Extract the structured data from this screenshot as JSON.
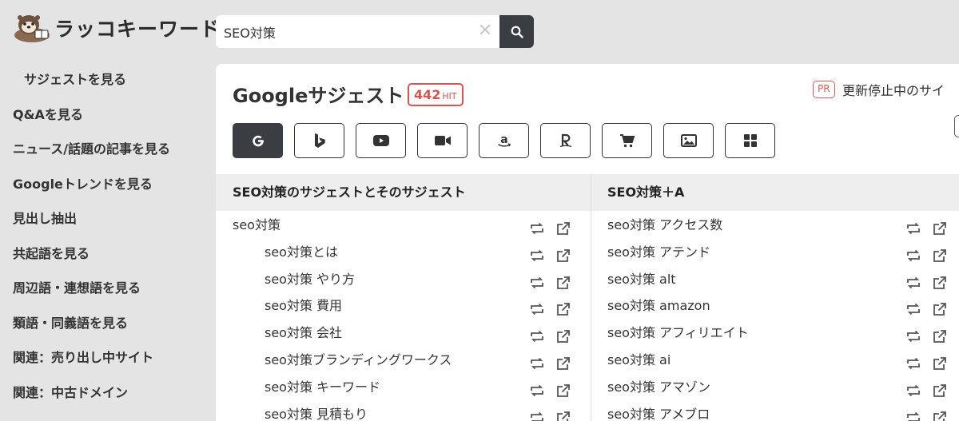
{
  "app": {
    "logo_text": "ラッコキーワード"
  },
  "search": {
    "value": "SEO対策",
    "clear_glyph": "✕"
  },
  "sidebar": {
    "items": [
      {
        "label": "サジェストを見る",
        "active": true
      },
      {
        "label": "Q&Aを見る"
      },
      {
        "label": "ニュース/話題の記事を見る"
      },
      {
        "label": "Googleトレンドを見る"
      },
      {
        "label": "見出し抽出"
      },
      {
        "label": "共起語を見る"
      },
      {
        "label": "周辺語・連想語を見る"
      },
      {
        "label": "類語・同義語を見る"
      },
      {
        "label": "関連：売り出し中サイト"
      },
      {
        "label": "関連：中古ドメイン"
      }
    ]
  },
  "main": {
    "title": "Googleサジェスト",
    "hit_count": "442",
    "hit_unit": "HIT",
    "pr_badge": "PR",
    "pr_text": "更新停止中のサイ",
    "engines": [
      {
        "name": "google",
        "icon": "google-icon",
        "active": true
      },
      {
        "name": "bing",
        "icon": "bing-icon"
      },
      {
        "name": "youtube",
        "icon": "youtube-icon"
      },
      {
        "name": "video",
        "icon": "video-camera-icon"
      },
      {
        "name": "amazon",
        "icon": "amazon-icon"
      },
      {
        "name": "rakuten",
        "icon": "rakuten-icon"
      },
      {
        "name": "shopping",
        "icon": "cart-icon"
      },
      {
        "name": "images",
        "icon": "image-icon"
      },
      {
        "name": "apps",
        "icon": "grid-icon"
      }
    ],
    "left_column": {
      "header": "SEO対策のサジェストとそのサジェスト",
      "rows": [
        {
          "text": "seo対策",
          "indent": false
        },
        {
          "text": "seo対策とは",
          "indent": true
        },
        {
          "text": "seo対策 やり方",
          "indent": true
        },
        {
          "text": "seo対策 費用",
          "indent": true
        },
        {
          "text": "seo対策 会社",
          "indent": true
        },
        {
          "text": "seo対策ブランディングワークス",
          "indent": true
        },
        {
          "text": "seo対策 キーワード",
          "indent": true
        },
        {
          "text": "seo対策 見積もり",
          "indent": true
        }
      ]
    },
    "right_column": {
      "header": "SEO対策＋A",
      "rows": [
        {
          "text": "seo対策 アクセス数"
        },
        {
          "text": "seo対策 アテンド"
        },
        {
          "text": "seo対策 alt"
        },
        {
          "text": "seo対策 amazon"
        },
        {
          "text": "seo対策 アフィリエイト"
        },
        {
          "text": "seo対策 ai"
        },
        {
          "text": "seo対策 アマゾン"
        },
        {
          "text": "seo対策 アメブロ"
        }
      ]
    }
  },
  "colors": {
    "dark": "#3a3d42",
    "accent_red": "#d9534f",
    "bg": "#e4e4e4",
    "icon_gray": "#555555"
  }
}
